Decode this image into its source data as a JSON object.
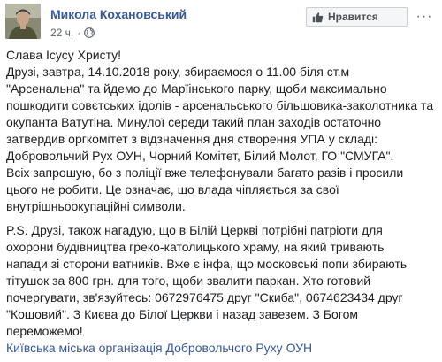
{
  "post": {
    "author": "Микола Кохановський",
    "time": "22 ч.",
    "dot": "·",
    "like_page_label": "Нравится",
    "more_label": "···",
    "paragraph1_lines": [
      "Слава Ісусу Христу!",
      "Друзі, завтра, 14.10.2018 року, збираємося о 11.00 біля ст.м",
      "\"Арсенальна\" та йдемо до Марїінського парку, щоби максимально",
      "пошкодити совєтських ідолів - арсенальського більшовика-заколотника та",
      "окупанта Ватутіна. Минулої середи такий план заходів остаточно",
      "затвердив оргкомітет з відзначення дня створення УПА у складі:",
      "Добровольчий Рух ОУН, Чорний Комітет, Білий Молот, ГО \"СМУГА\".",
      "Всіх запрошую, бо з поліції вже телефонували багато разів і просили",
      "цього не робити. Це означає, що влада чіпляється за свої",
      "внутрішньоокупаційні символи."
    ],
    "paragraph2_lines": [
      "P.S. Друзі, також нагадую, що в Білій Церкві потрібні патріоти для",
      "охорони будівництва греко-католицького храму, на який тривають",
      "напади зі сторони ватників. Вже є інфа, що московські попи збирають",
      "тітушок за 800 грн. для того, щоби звалити паркан. Хто готовий",
      "почергувати, зв'язуйтесь: 0672976475 друг \"Скиба\", 0674623434 друг",
      "\"Кошовий\". З Києва до Білої Церкви і назад завезем. З Богом",
      "переможемо!"
    ],
    "signature": "Київська міська організація Добровольчого Руху ОУН"
  },
  "colors": {
    "link": "#385898",
    "author": "#365899",
    "meta": "#616770",
    "text": "#1c1e21"
  },
  "icons": {
    "globe": "globe-icon",
    "like": "thumbs-up-icon",
    "more": "more-icon"
  }
}
